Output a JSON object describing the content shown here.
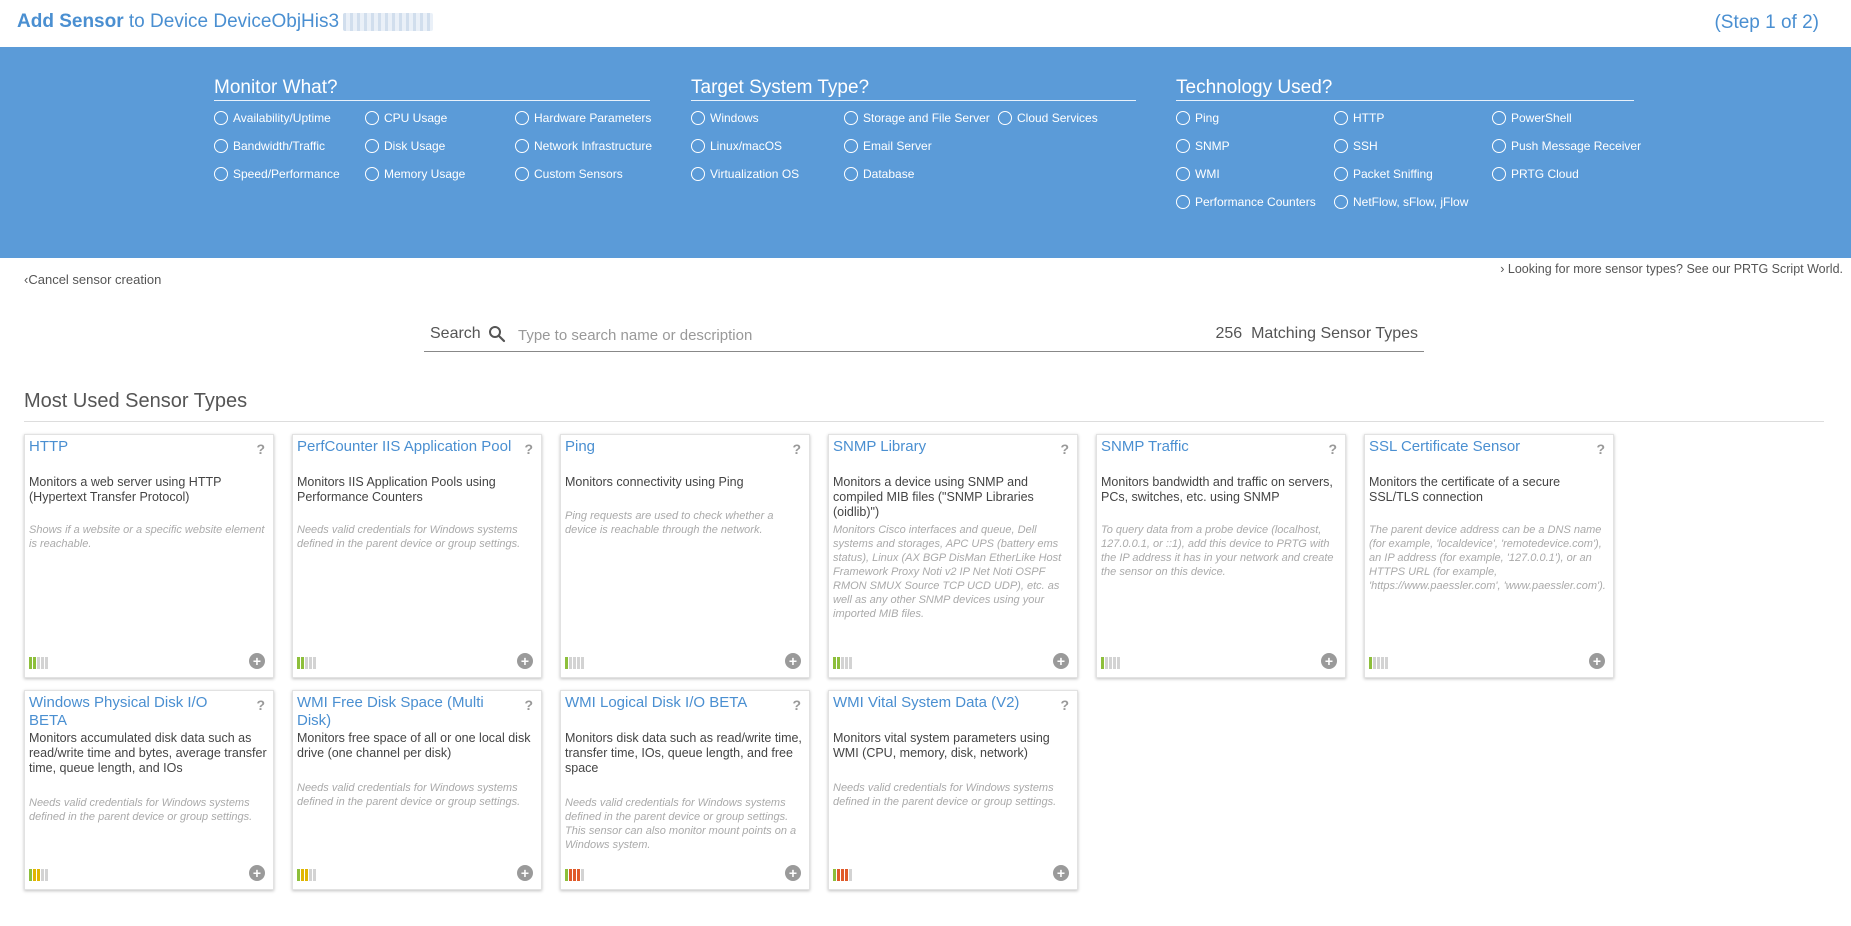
{
  "header": {
    "title_prefix": "Add Sensor",
    "title_mid": "to Device",
    "device_name": "DeviceObjHis3",
    "step": "(Step 1 of 2)"
  },
  "filters": {
    "monitor_what": {
      "heading": "Monitor What?",
      "options": [
        "Availability/Uptime",
        "CPU Usage",
        "Hardware Parameters",
        "Bandwidth/Traffic",
        "Disk Usage",
        "Network Infrastructure",
        "Speed/Performance",
        "Memory Usage",
        "Custom Sensors"
      ]
    },
    "target_system": {
      "heading": "Target System Type?",
      "options": [
        "Windows",
        "Storage and File Server",
        "Cloud Services",
        "Linux/macOS",
        "Email Server",
        "Virtualization OS",
        "Database"
      ]
    },
    "technology": {
      "heading": "Technology Used?",
      "options": [
        "Ping",
        "HTTP",
        "PowerShell",
        "SNMP",
        "SSH",
        "Push Message Receiver",
        "WMI",
        "Packet Sniffing",
        "PRTG Cloud",
        "Performance Counters",
        "NetFlow, sFlow, jFlow"
      ]
    }
  },
  "links": {
    "cancel": "Cancel sensor creation",
    "script_world": "Looking for more sensor types? See our PRTG Script World."
  },
  "search": {
    "label": "Search",
    "placeholder": "Type to search name or description",
    "count": "256",
    "count_label": "Matching Sensor Types"
  },
  "section_title": "Most Used Sensor Types",
  "cards": [
    {
      "name": "HTTP",
      "desc": "Monitors a web server using HTTP (Hypertext Transfer Protocol)",
      "note": "Shows if a website or a specific website element is reachable.",
      "level": 2,
      "color": "#8dbf3b"
    },
    {
      "name": "PerfCounter IIS Application Pool",
      "desc": "Monitors IIS Application Pools using Performance Counters",
      "note": "Needs valid credentials for Windows systems defined in the parent device or group settings.",
      "level": 2,
      "color": "#8dbf3b"
    },
    {
      "name": "Ping",
      "desc": "Monitors connectivity using Ping",
      "note": "Ping requests are used to check whether a device is reachable through the network.",
      "level": 1,
      "color": "#8dbf3b"
    },
    {
      "name": "SNMP Library",
      "desc": "Monitors a device using SNMP and compiled MIB files (\"SNMP Libraries (oidlib)\")",
      "note": "Monitors Cisco interfaces and queue, Dell systems and storages, APC UPS (battery ems status), Linux (AX BGP DisMan EtherLike Host Framework Proxy Noti v2 IP Net Noti OSPF RMON SMUX Source TCP UCD UDP), etc. as well as any other SNMP devices using your imported MIB files.",
      "level": 2,
      "color": "#8dbf3b"
    },
    {
      "name": "SNMP Traffic",
      "desc": "Monitors bandwidth and traffic on servers, PCs, switches, etc. using SNMP",
      "note": "To query data from a probe device (localhost, 127.0.0.1, or ::1), add this device to PRTG with the IP address it has in your network and create the sensor on this device.",
      "level": 1,
      "color": "#8dbf3b"
    },
    {
      "name": "SSL Certificate Sensor",
      "desc": "Monitors the certificate of a secure SSL/TLS connection",
      "note": "The parent device address can be a DNS name (for example, 'localdevice', 'remotedevice.com'), an IP address (for example, '127.0.0.1'), or an HTTPS URL (for example, 'https://www.paessler.com', 'www.paessler.com').",
      "level": 1,
      "color": "#8dbf3b"
    },
    {
      "name": "Windows Physical Disk I/O BETA",
      "desc": "Monitors accumulated disk data such as read/write time and bytes, average transfer time, queue length, and IOs",
      "note": "Needs valid credentials for Windows systems defined in the parent device or group settings.",
      "level": 3,
      "color": "#e0b500"
    },
    {
      "name": "WMI Free Disk Space (Multi Disk)",
      "desc": "Monitors free space of all or one local disk drive (one channel per disk)",
      "note": "Needs valid credentials for Windows systems defined in the parent device or group settings.",
      "level": 3,
      "color": "#e0b500"
    },
    {
      "name": "WMI Logical Disk I/O BETA",
      "desc": "Monitors disk data such as read/write time, transfer time, IOs, queue length, and free space",
      "note": "Needs valid credentials for Windows systems defined in the parent device or group settings. This sensor can also monitor mount points on a Windows system.",
      "level": 4,
      "color": "#e05a2a"
    },
    {
      "name": "WMI Vital System Data (V2)",
      "desc": "Monitors vital system parameters using WMI (CPU, memory, disk, network)",
      "note": "Needs valid credentials for Windows systems defined in the parent device or group settings.",
      "level": 4,
      "color": "#e05a2a"
    }
  ]
}
